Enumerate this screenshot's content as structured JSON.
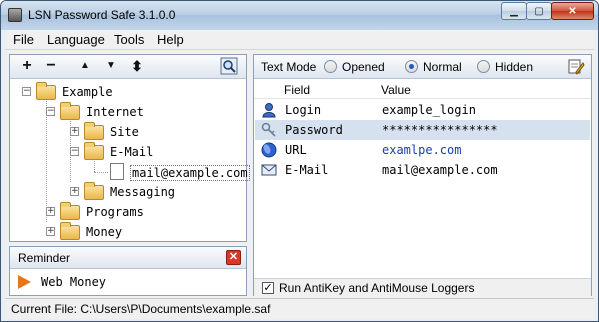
{
  "window": {
    "title": "LSN Password Safe 3.1.0.0",
    "min_glyph": "▁",
    "max_glyph": "▢",
    "close_glyph": "✕"
  },
  "menu": {
    "items": [
      "File",
      "Language",
      "Tools",
      "Help"
    ]
  },
  "toolbar": {
    "add": "+",
    "remove": "−",
    "up": "▲",
    "down": "▼",
    "move": "⬍",
    "search_icon": "magnifier-icon"
  },
  "tree": {
    "root": "Example",
    "internet": "Internet",
    "site": "Site",
    "email": "E-Mail",
    "mail_item": "mail@example.com",
    "messaging": "Messaging",
    "programs": "Programs",
    "money": "Money",
    "expand": "+",
    "collapse": "−"
  },
  "reminder": {
    "title": "Reminder",
    "close": "✕",
    "item": "Web Money"
  },
  "textmode": {
    "label": "Text Mode",
    "options": [
      "Opened",
      "Normal",
      "Hidden"
    ],
    "selected": "Normal"
  },
  "fields": {
    "header_field": "Field",
    "header_value": "Value",
    "rows": [
      {
        "field": "Login",
        "value": "example_login",
        "icon": "user-icon"
      },
      {
        "field": "Password",
        "value": "****************",
        "icon": "key-icon"
      },
      {
        "field": "URL",
        "value": "examlpe.com",
        "icon": "globe-icon"
      },
      {
        "field": "E-Mail",
        "value": "mail@example.com",
        "icon": "envelope-icon"
      }
    ],
    "selected_row": "Password"
  },
  "antikey": {
    "label": "Run AntiKey and AntiMouse Loggers",
    "checked": true,
    "check_glyph": "✓"
  },
  "status": {
    "text": "Current File: C:\\Users\\P\\Documents\\example.saf"
  }
}
